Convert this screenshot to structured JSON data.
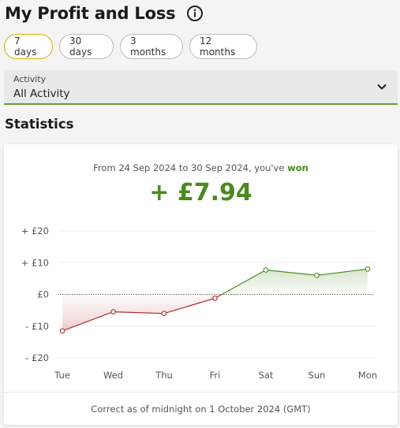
{
  "header": {
    "title": "My Profit and Loss",
    "info_icon": "info-icon"
  },
  "tabs": [
    {
      "label": "7 days",
      "active": true
    },
    {
      "label": "30 days",
      "active": false
    },
    {
      "label": "3 months",
      "active": false
    },
    {
      "label": "12 months",
      "active": false
    }
  ],
  "filter": {
    "label": "Activity",
    "value": "All Activity",
    "icon": "chevron-down-icon"
  },
  "statistics": {
    "title": "Statistics",
    "summary_prefix": "From 24 Sep 2024 to 30 Sep 2024, you've",
    "summary_outcome": "won",
    "amount": "+ £7.94",
    "footer": "Correct as of midnight on 1 October 2024 (GMT)"
  },
  "colors": {
    "positive": "#4a8a1f",
    "negative": "#b22a2a",
    "active_tab_border": "#d7b400"
  },
  "chart_data": {
    "type": "line",
    "categories": [
      "Tue",
      "Wed",
      "Thu",
      "Fri",
      "Sat",
      "Sun",
      "Mon"
    ],
    "values": [
      -11.5,
      -5.5,
      -6,
      -1.2,
      7.7,
      6,
      8
    ],
    "ylim": [
      -20,
      20
    ],
    "yticks": [
      20,
      10,
      0,
      -10,
      -20
    ],
    "ytick_labels": [
      "+ £20",
      "+ £10",
      "£0",
      "- £10",
      "- £20"
    ],
    "grid": true,
    "zero_line": "dotted"
  }
}
